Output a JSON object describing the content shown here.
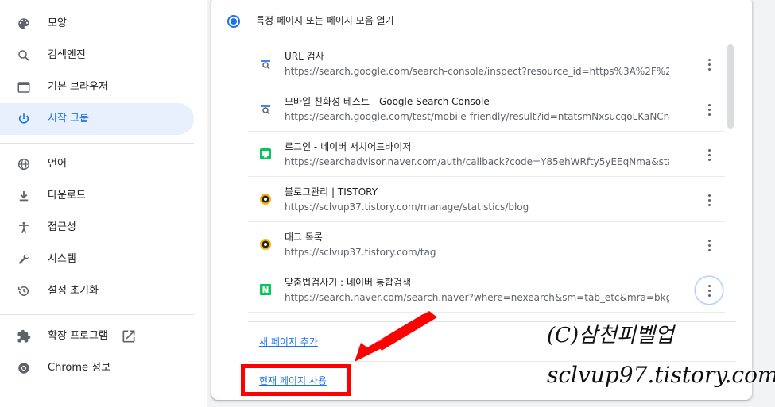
{
  "sidebar": {
    "items": [
      {
        "label": "모양",
        "icon": "palette-icon"
      },
      {
        "label": "검색엔진",
        "icon": "search-icon"
      },
      {
        "label": "기본 브라우저",
        "icon": "browser-window-icon"
      },
      {
        "label": "시작 그룹",
        "icon": "power-icon",
        "active": true
      },
      {
        "label": "언어",
        "icon": "globe-icon"
      },
      {
        "label": "다운로드",
        "icon": "download-icon"
      },
      {
        "label": "접근성",
        "icon": "accessibility-icon"
      },
      {
        "label": "시스템",
        "icon": "wrench-icon"
      },
      {
        "label": "설정 초기화",
        "icon": "history-icon"
      },
      {
        "label": "확장 프로그램",
        "icon": "puzzle-icon"
      },
      {
        "label": "Chrome 정보",
        "icon": "chrome-icon"
      }
    ]
  },
  "startup": {
    "radio_label": "특정 페이지 또는 페이지 모음 열기",
    "pages": [
      {
        "title": "URL 검사",
        "url": "https://search.google.com/search-console/inspect?resource_id=https%3A%2F%2...",
        "favicon": "search-console-icon"
      },
      {
        "title": "모바일 친화성 테스트 - Google Search Console",
        "url": "https://search.google.com/test/mobile-friendly/result?id=ntatsmNxsucqoLKaNCn...",
        "favicon": "search-console-icon"
      },
      {
        "title": "로그인 - 네이버 서치어드바이저",
        "url": "https://searchadvisor.naver.com/auth/callback?code=Y85ehWRfty5yEEqNma&sta...",
        "favicon": "naver-searchadvisor-icon"
      },
      {
        "title": "블로그관리 | TISTORY",
        "url": "https://sclvup37.tistory.com/manage/statistics/blog",
        "favicon": "tistory-icon"
      },
      {
        "title": "태그 목록",
        "url": "https://sclvup37.tistory.com/tag",
        "favicon": "tistory-icon"
      },
      {
        "title": "맞춤법검사기 : 네이버 통합검색",
        "url": "https://search.naver.com/search.naver?where=nexearch&sm=tab_etc&mra=bkgy&...",
        "favicon": "naver-icon"
      }
    ],
    "add_page": "새 페이지 추가",
    "use_current": "현재 페이지 사용"
  },
  "watermark": {
    "line1": "(C)삼천피벨업",
    "line2": "sclvup97.tistory.com"
  },
  "colors": {
    "accent": "#1a73e8",
    "annotation": "#ff0000"
  }
}
